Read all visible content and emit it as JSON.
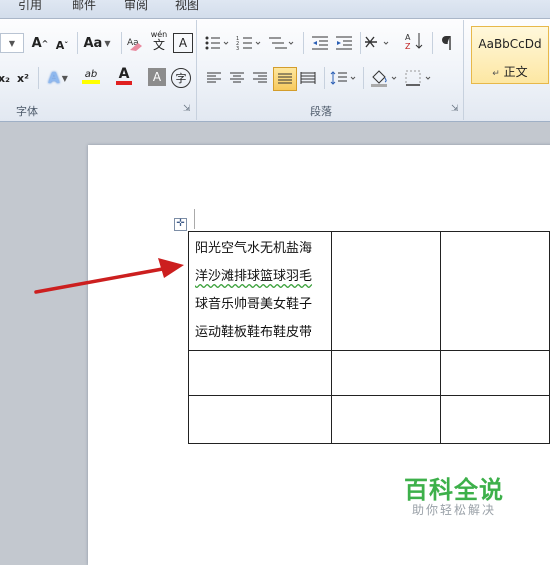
{
  "tabs": [
    "引用",
    "邮件",
    "审阅",
    "视图"
  ],
  "ribbon": {
    "font_group": {
      "label": "字体",
      "grow_font": "A",
      "shrink_font": "A",
      "change_case": "Aa",
      "pinyin": "wén",
      "char_border": "A",
      "subscript": "x₂",
      "superscript": "x²",
      "text_effect": "A",
      "highlight": "ab",
      "font_color": "A",
      "char_shading": "A",
      "enclose": "字"
    },
    "paragraph_group": {
      "label": "段落"
    },
    "styles": {
      "sample": "AaBbCcDd",
      "name": "正文"
    }
  },
  "document": {
    "table": {
      "cell_1_1_lines": [
        "阳光空气水无机盐海",
        "洋沙滩排球篮球羽毛",
        "球音乐帅哥美女鞋子",
        "运动鞋板鞋布鞋皮带"
      ]
    }
  },
  "watermark": {
    "title": "百科全说",
    "subtitle": "助你轻松解决"
  },
  "colors": {
    "arrow": "#cc1f1f",
    "watermark_green": "#3db04a",
    "font_color_bar": "#e02020",
    "highlight_bar": "#ffff00"
  }
}
